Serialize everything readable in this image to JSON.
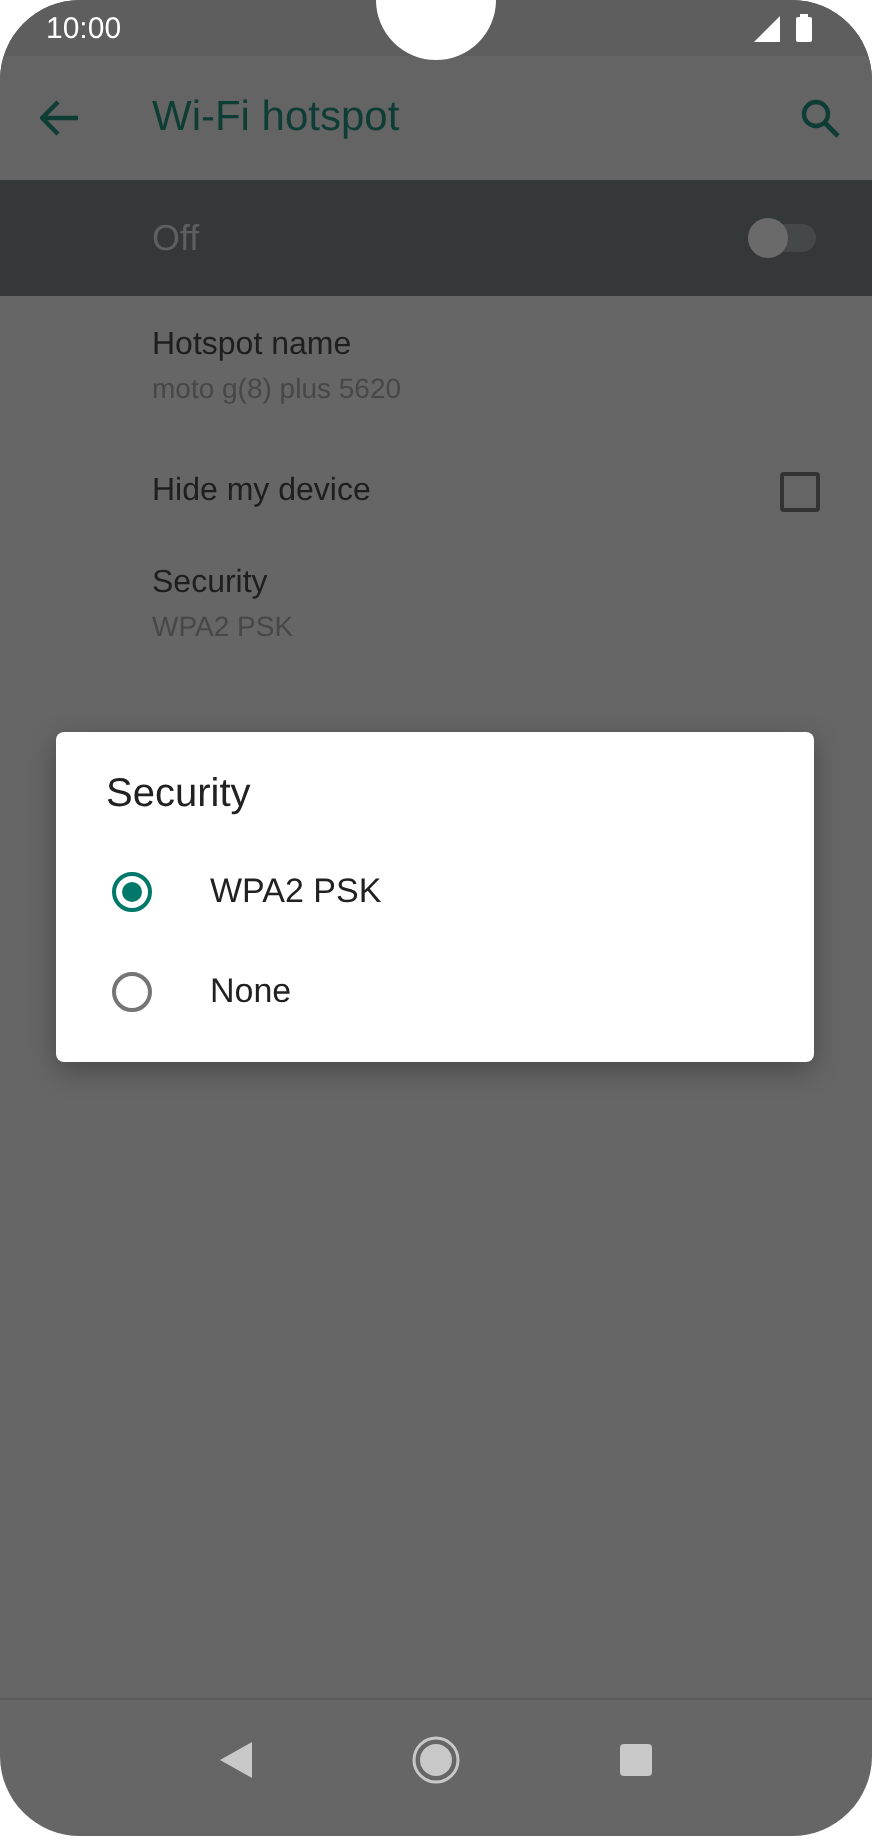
{
  "status_bar": {
    "time": "10:00"
  },
  "app_bar": {
    "title": "Wi-Fi hotspot"
  },
  "master_switch": {
    "label": "Off",
    "on": false
  },
  "settings": [
    {
      "kind": "text",
      "title": "Hotspot name",
      "summary": "moto g(8) plus 5620"
    },
    {
      "kind": "checkbox",
      "title": "Hide my device",
      "checked": false
    },
    {
      "kind": "text",
      "title": "Security",
      "summary": "WPA2 PSK"
    }
  ],
  "dialog": {
    "title": "Security",
    "options": [
      {
        "label": "WPA2 PSK",
        "selected": true
      },
      {
        "label": "None",
        "selected": false
      }
    ]
  }
}
